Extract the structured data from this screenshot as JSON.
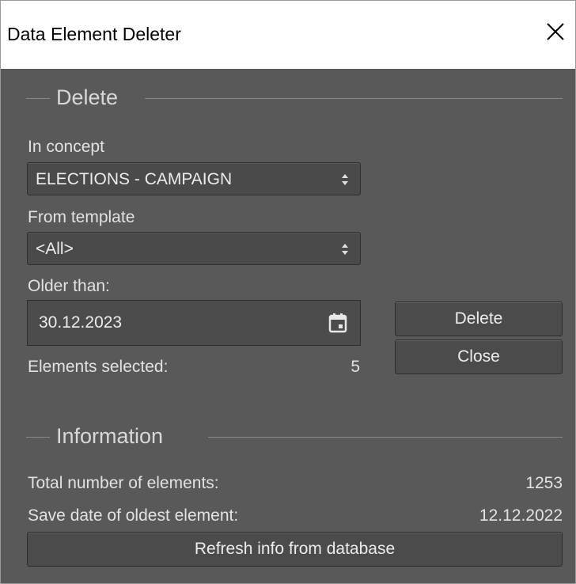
{
  "window": {
    "title": "Data Element Deleter",
    "close_glyph": "✕"
  },
  "delete_group": {
    "title": "Delete",
    "concept_label": "In concept",
    "concept_value": "ELECTIONS - CAMPAIGN",
    "template_label": "From template",
    "template_value": "<All>",
    "older_label": "Older than:",
    "older_value": "30.12.2023",
    "selected_label": "Elements selected:",
    "selected_value": "5",
    "delete_button": "Delete",
    "close_button": "Close"
  },
  "info_group": {
    "title": "Information",
    "total_label": "Total number of elements:",
    "total_value": "1253",
    "oldest_label": "Save date of oldest element:",
    "oldest_value": "12.12.2022",
    "refresh_button": "Refresh info from database"
  },
  "icons": {
    "close": "close-icon",
    "combo_arrows": "up-down-arrows-icon",
    "calendar": "calendar-icon"
  },
  "colors": {
    "panel": "#595959",
    "field": "#4a4a4a",
    "text": "#e2e2e2",
    "titlebar": "#ffffff"
  }
}
